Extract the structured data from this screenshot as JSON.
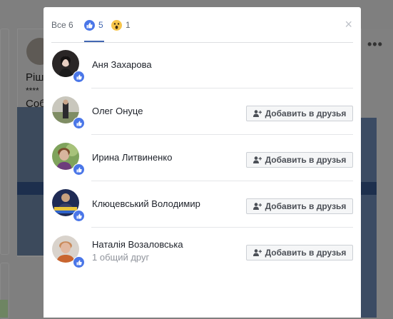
{
  "background": {
    "post_text_line1": "Ріш",
    "post_text_line2": "****",
    "post_text_line3": "Соб",
    "more_dots": "•••"
  },
  "modal": {
    "tabs": {
      "all_label": "Все 6",
      "like_count": "5",
      "wow_count": "1"
    },
    "close_glyph": "×",
    "add_friend_label": "Добавить в друзья",
    "people": [
      {
        "name": "Аня Захарова",
        "sub": "",
        "show_button": false
      },
      {
        "name": "Олег Онуце",
        "sub": "",
        "show_button": true
      },
      {
        "name": "Ирина Литвиненко",
        "sub": "",
        "show_button": true
      },
      {
        "name": "Клюцевський Володимир",
        "sub": "",
        "show_button": true
      },
      {
        "name": "Наталія Возаловська",
        "sub": "1 общий друг",
        "show_button": true
      }
    ]
  },
  "colors": {
    "like_blue": "#4a76e8",
    "accent": "#4267b2",
    "wow_yellow": "#f7c54a"
  }
}
